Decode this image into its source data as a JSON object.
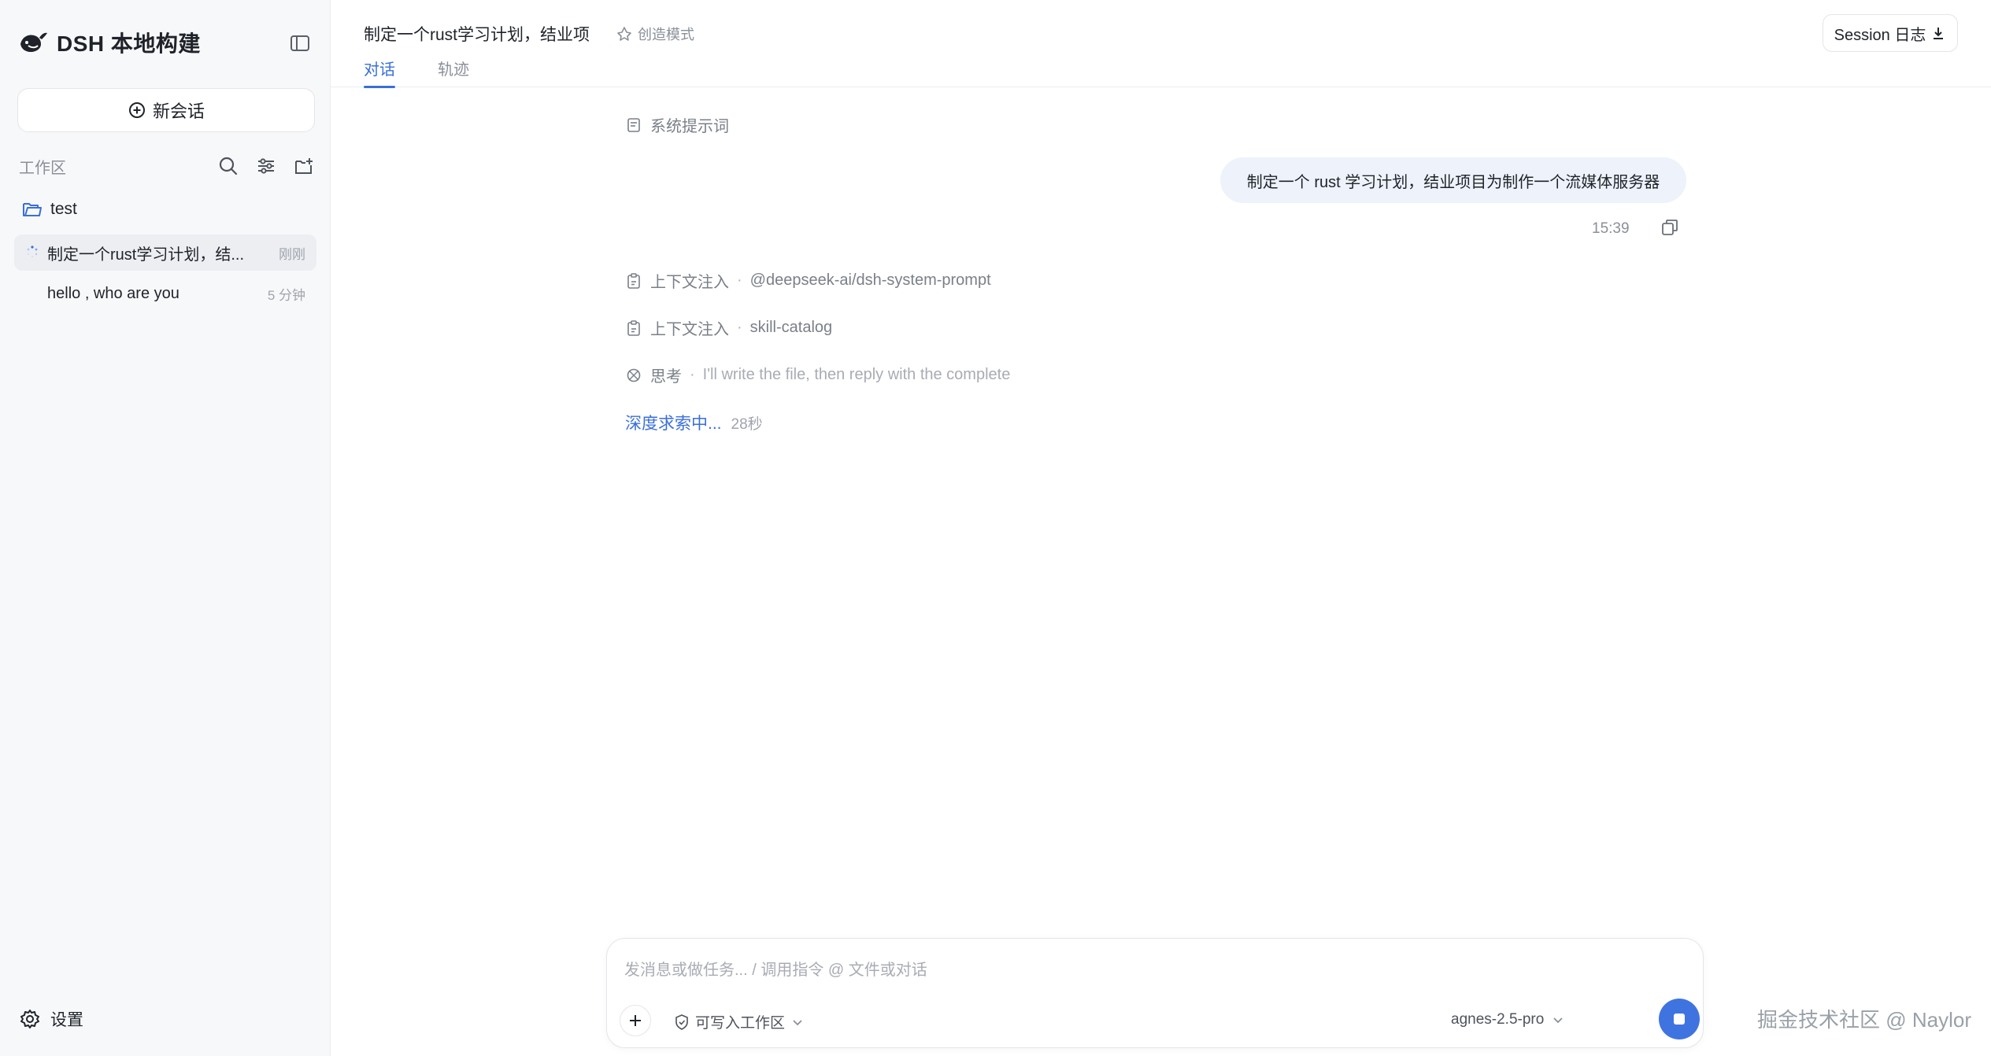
{
  "app": {
    "brand": "DSH 本地构建"
  },
  "sidebar": {
    "new_chat_label": "新会话",
    "workspace_title": "工作区",
    "folder": "test",
    "sessions": [
      {
        "title": "制定一个rust学习计划，结...",
        "time": "刚刚",
        "active": true,
        "loading": true
      },
      {
        "title": "hello , who are you",
        "time": "5 分钟",
        "active": false,
        "loading": false
      }
    ],
    "settings_label": "设置"
  },
  "header": {
    "conversation_title": "制定一个rust学习计划，结业项",
    "mode_label": "创造模式",
    "tabs": [
      {
        "label": "对话",
        "active": true
      },
      {
        "label": "轨迹",
        "active": false
      }
    ],
    "session_log_label": "Session 日志"
  },
  "conversation": {
    "system_prompt_label": "系统提示词",
    "user_message": "制定一个 rust 学习计划，结业项目为制作一个流媒体服务器",
    "user_message_time": "15:39",
    "steps": [
      {
        "label": "上下文注入",
        "detail": "@deepseek-ai/dsh-system-prompt",
        "icon": "context-icon",
        "faded": false
      },
      {
        "label": "上下文注入",
        "detail": "skill-catalog",
        "icon": "context-icon",
        "faded": false
      },
      {
        "label": "思考",
        "detail": "I'll write the file, then reply with the complete",
        "icon": "thinking-icon",
        "faded": true
      }
    ],
    "status_text": "深度求索中...",
    "status_elapsed": "28秒"
  },
  "composer": {
    "placeholder": "发消息或做任务... / 调用指令 @ 文件或对话",
    "value": "",
    "permission_label": "可写入工作区",
    "model_label": "agnes-2.5-pro"
  },
  "watermark": "掘金技术社区 @ Naylor",
  "colors": {
    "accent": "#3a6fd8",
    "stop_button": "#3f74e0",
    "user_bubble": "#eef2fb",
    "sidebar_bg": "#f7f8fa"
  }
}
